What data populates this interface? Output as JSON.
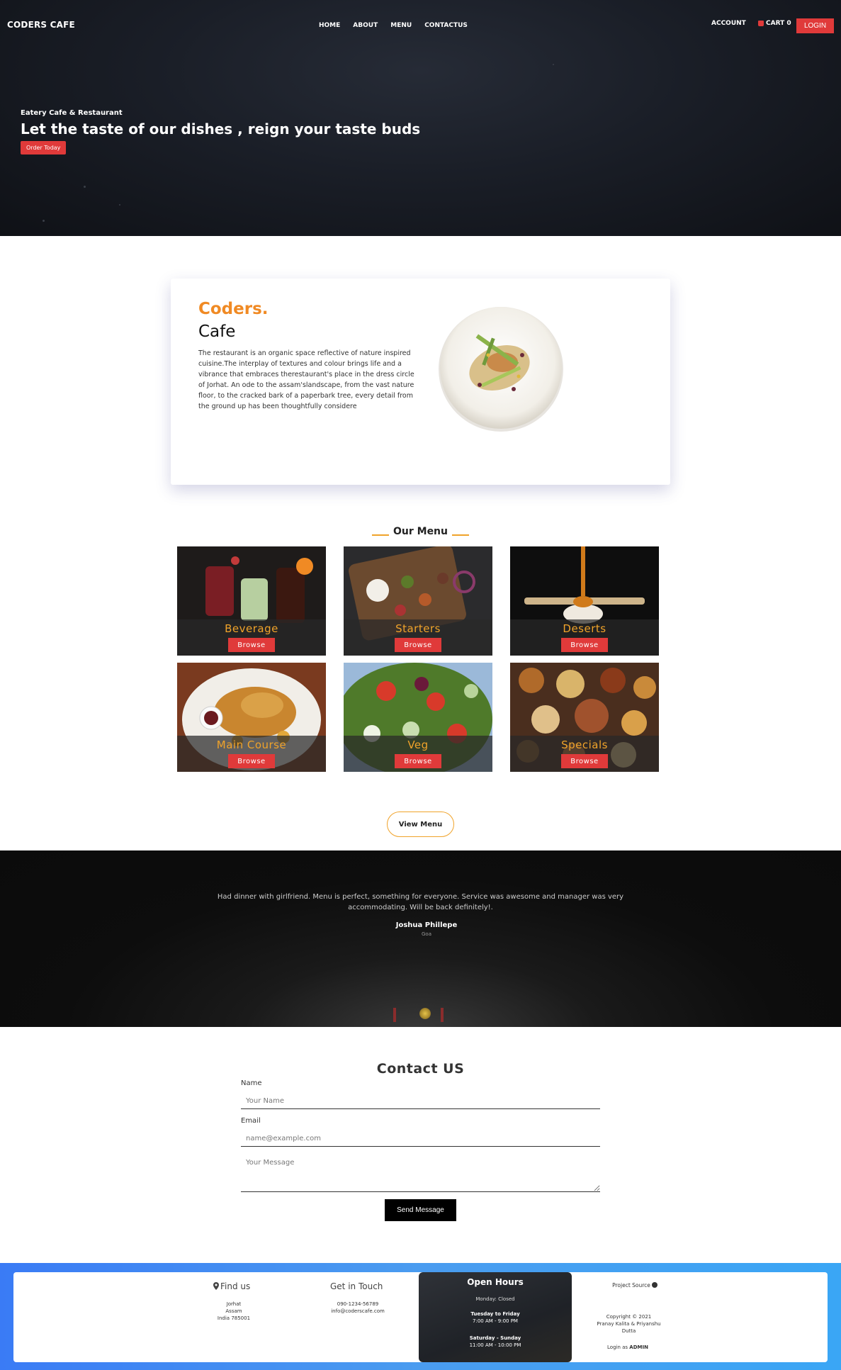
{
  "header": {
    "brand": "CODERS CAFE",
    "nav": [
      "HOME",
      "ABOUT",
      "MENU",
      "CONTACTUS"
    ],
    "account": "ACCOUNT",
    "cart": "CART 0",
    "login": "LOGIN"
  },
  "hero": {
    "eyebrow": "Eatery Cafe & Restaurant",
    "title": "Let the taste of our dishes , reign your taste buds",
    "cta": "Order Today"
  },
  "about": {
    "title_accent": "Coders.",
    "title": "Cafe",
    "description": "The restaurant is an organic space reflective of nature inspired cuisine.The interplay of textures and colour brings life and a vibrance that embraces therestaurant's place in the dress circle of Jorhat. An ode to the assam'slandscape, from the vast nature floor, to the cracked bark of a paperbark tree, every detail from the ground up has been thoughtfully considere"
  },
  "menu": {
    "heading": "Our Menu",
    "browse_label": "Browse",
    "items": [
      {
        "name": "Beverage"
      },
      {
        "name": "Starters"
      },
      {
        "name": "Deserts"
      },
      {
        "name": "Main Course"
      },
      {
        "name": "Veg"
      },
      {
        "name": "Specials"
      }
    ],
    "view_menu": "View Menu"
  },
  "testimonial": {
    "quote": "Had dinner with girlfriend. Menu is perfect, something for everyone. Service was awesome and manager was very accommodating. Will be back definitely!.",
    "author": "Joshua Phillepe",
    "location": "Goa"
  },
  "contact": {
    "title": "Contact US",
    "name_label": "Name",
    "name_placeholder": "Your Name",
    "email_label": "Email",
    "email_placeholder": "name@example.com",
    "message_placeholder": "Your Message",
    "send": "Send Message"
  },
  "footer": {
    "find_us": "Find us",
    "address": [
      "Jorhat",
      "Assam",
      "India 785001"
    ],
    "get_in_touch": "Get in Touch",
    "phone": "090-1234-56789",
    "email": "info@coderscafe.com",
    "open_hours": "Open Hours",
    "monday": "Monday: Closed",
    "weekday_label": "Tuesday to Friday",
    "weekday_hours": "7:00 AM - 9:00 PM",
    "weekend_label": "Saturday - Sunday",
    "weekend_hours": "11:00 AM - 10:00 PM",
    "project_source": "Project Source",
    "copyright": "Copyright © 2021",
    "authors": "Pranay Kalita & Priyanshu",
    "authors2": "Dutta",
    "login_as": "Login as",
    "admin": "ADMIN"
  },
  "colors": {
    "accent_red": "#e03a3a",
    "accent_orange": "#f08a24",
    "accent_gold": "#f0a32a",
    "footer_blue": "#3a7bf5"
  }
}
